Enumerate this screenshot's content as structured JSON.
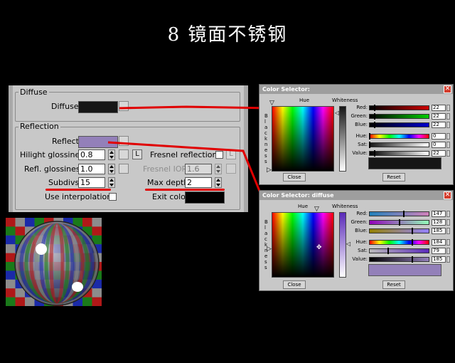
{
  "title": "8 镜面不锈钢",
  "panel": {
    "diffuse_group": "Diffuse",
    "diffuse_label": "Diffuse",
    "diffuse_color": "#161616",
    "reflection_group": "Reflection",
    "reflect_label": "Reflect",
    "reflect_color": "#9380b9",
    "hilight_label": "Hilight glossiness",
    "hilight_value": "0.8",
    "l_label": "L",
    "fresnel_label": "Fresnel reflections",
    "refl_label": "Refl. glossiness",
    "refl_value": "1.0",
    "fresnel_ior_label": "Fresnel IOR",
    "fresnel_ior_value": "1.6",
    "subdivs_label": "Subdivs",
    "subdivs_value": "15",
    "maxdepth_label": "Max depth",
    "maxdepth_value": "2",
    "interp_label": "Use interpolation",
    "exit_label": "Exit color",
    "exit_color": "#000000"
  },
  "dialog1": {
    "title": "Color Selector:",
    "hue": "Hue",
    "whiteness": "Whiteness",
    "blackness": "Blackness",
    "red": "Red:",
    "red_value": "22",
    "green": "Green:",
    "green_value": "22",
    "blue": "Blue:",
    "blue_value": "22",
    "hue_lbl": "Hue:",
    "hue_value": "0",
    "sat_lbl": "Sat:",
    "sat_value": "0",
    "value_lbl": "Value:",
    "value_value": "22",
    "close": "Close",
    "reset": "Reset",
    "preview_color": "#161616"
  },
  "dialog2": {
    "title": "Color Selector: diffuse",
    "hue": "Hue",
    "whiteness": "Whiteness",
    "blackness": "Blackness",
    "red": "Red:",
    "red_value": "147",
    "green": "Green:",
    "green_value": "128",
    "blue": "Blue:",
    "blue_value": "185",
    "hue_lbl": "Hue:",
    "hue_value": "184",
    "sat_lbl": "Sat:",
    "sat_value": "79",
    "value_lbl": "Value:",
    "value_value": "185",
    "close": "Close",
    "reset": "Reset",
    "preview_color": "#9380b9"
  },
  "colors": {
    "annotation_red": "#e00000",
    "panel_bg": "#c8c8c8",
    "checker_red": "#b01818",
    "checker_green": "#1a7a1a",
    "checker_blue": "#1a2aa8",
    "checker_gray": "#8c8c8c"
  }
}
